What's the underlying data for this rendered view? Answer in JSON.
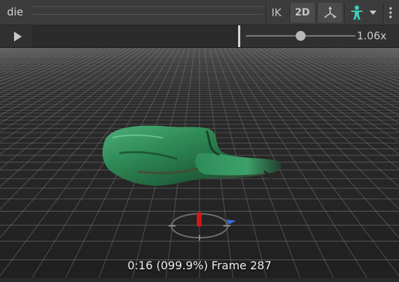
{
  "window": {
    "title": "die"
  },
  "toolbar": {
    "ik_label": "IK",
    "twod_label": "2D",
    "gizmo_icon": "transform-axes-icon",
    "avatar_icon": "humanoid-avatar-icon",
    "dropdown_icon": "chevron-down-icon",
    "menu_icon": "kebab-menu-icon"
  },
  "playback": {
    "play_icon": "play-icon",
    "speed": "1.06x",
    "speed_fraction": 0.5
  },
  "viewport": {
    "frame_info": "0:16 (099.9%) Frame 287"
  },
  "colors": {
    "accent_teal": "#3fc9b8",
    "model_green": "#2e8a55",
    "grid": "#8a8a8a",
    "pivot_red": "#d01818",
    "pivot_blue": "#3a6fd8"
  }
}
